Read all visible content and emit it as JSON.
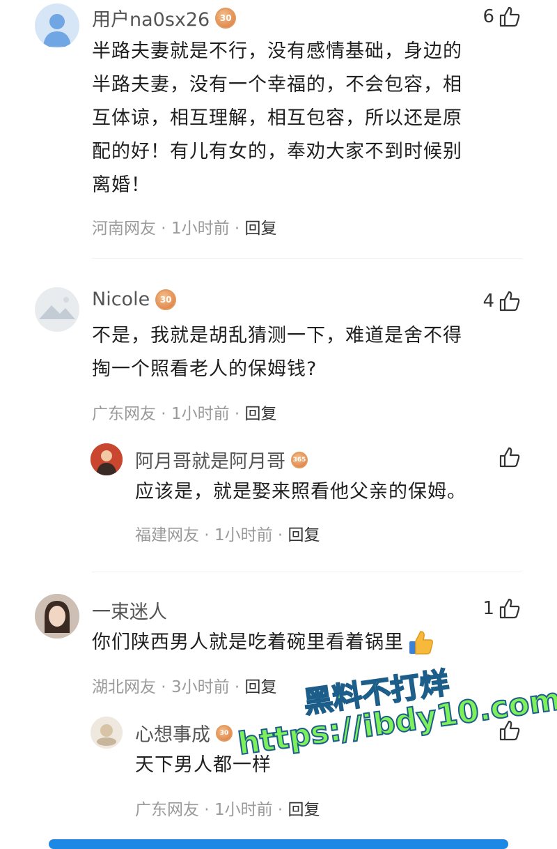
{
  "comments": [
    {
      "username": "用户na0sx26",
      "badge": "30",
      "likes": "6",
      "lines": [
        "半路夫妻就是不行，没有感情基础，身边的",
        "半路夫妻，没有一个幸福的，不会包容，相",
        "互体谅，相互理解，相互包容，所以还是原",
        "配的好！有儿有女的，奉劝大家不到时候别",
        "离婚！"
      ],
      "location": "河南网友",
      "time": "1小时前",
      "reply": "回复"
    },
    {
      "username": "Nicole",
      "badge": "30",
      "likes": "4",
      "lines": [
        "不是，我就是胡乱猜测一下，难道是舍不得",
        "掏一个照看老人的保姆钱?"
      ],
      "location": "广东网友",
      "time": "1小时前",
      "reply": "回复"
    },
    {
      "username": "阿月哥就是阿月哥",
      "badge": "365",
      "likes": "",
      "lines": [
        "应该是，就是娶来照看他父亲的保姆。"
      ],
      "location": "福建网友",
      "time": "1小时前",
      "reply": "回复"
    },
    {
      "username": "一束迷人",
      "badge": "",
      "likes": "1",
      "lines": [
        "你们陕西男人就是吃着碗里看着锅里"
      ],
      "location": "湖北网友",
      "time": "3小时前",
      "reply": "回复"
    },
    {
      "username": "心想事成",
      "badge": "30",
      "likes": "",
      "lines": [
        "天下男人都一样"
      ],
      "location": "广东网友",
      "time": "1小时前",
      "reply": "回复"
    }
  ],
  "watermark": {
    "line1": "黑料不打烊",
    "line2": "https://ibdy10.com"
  },
  "colors": {
    "meta": "#9a9a9a",
    "badge": "#d9773a",
    "accent_bar": "#1e88e5"
  }
}
